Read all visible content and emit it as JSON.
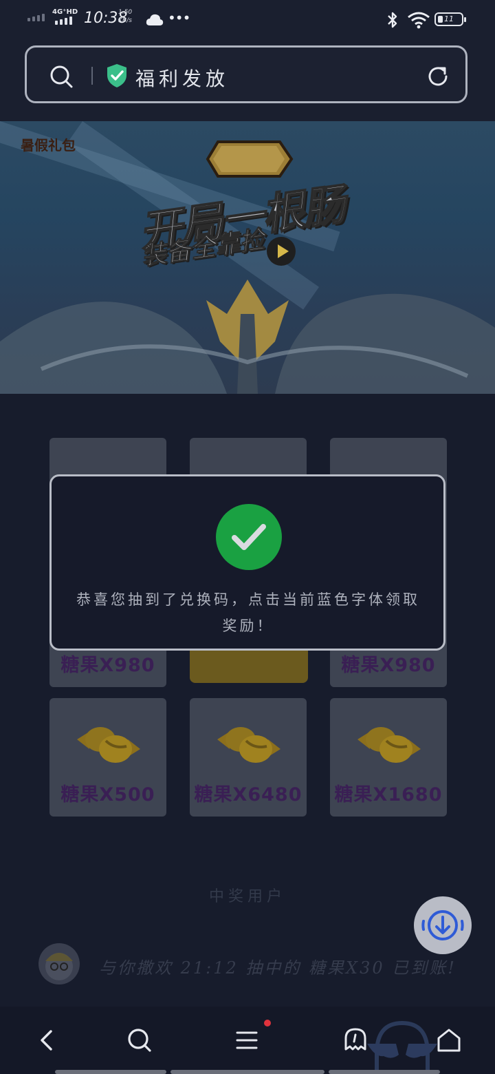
{
  "status_bar": {
    "network": "4G⁺HD",
    "time": "10:38",
    "speed_value": "1.50",
    "speed_unit": "KB/s",
    "more": "•••",
    "battery_level": "11"
  },
  "address_bar": {
    "text": "福利发放"
  },
  "banner": {
    "badge": "暑假礼包",
    "headline": "开局一根肠",
    "subline": "装备全靠捡"
  },
  "prizes": [
    {
      "label": "糖果X980"
    },
    {
      "label": "糖果X980"
    },
    {
      "label": "糖果X500"
    },
    {
      "label": "糖果X6480"
    },
    {
      "label": "糖果X1680"
    }
  ],
  "modal": {
    "message": "恭喜您抽到了兑换码，点击当前蓝色字体领取奖励！"
  },
  "winners": {
    "title": "中奖用户",
    "ticker": "与你撒欢 21:12 抽中的 糖果X30 已到账!"
  },
  "colors": {
    "success": "#1aa142",
    "accent_blue": "#2f5bd6",
    "notification": "#e0333d"
  }
}
